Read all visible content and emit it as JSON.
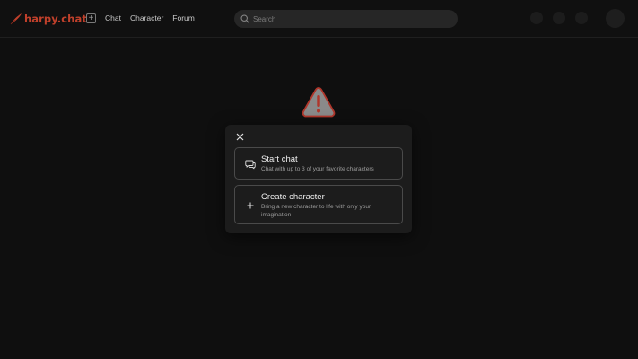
{
  "header": {
    "logo_text": "harpy.chat",
    "nav": [
      {
        "label": "Chat"
      },
      {
        "label": "Character"
      },
      {
        "label": "Forum"
      }
    ],
    "search": {
      "placeholder": "Search",
      "value": ""
    }
  },
  "modal": {
    "options": [
      {
        "title": "Start chat",
        "description": "Chat with up to 3 of your favorite characters",
        "icon": "chat-bubbles-icon"
      },
      {
        "title": "Create character",
        "description": "Bring a new character to life with only your imagination",
        "icon": "plus-icon"
      }
    ]
  },
  "colors": {
    "brand": "#c0402b",
    "background": "#0f0f0f",
    "modal": "#1c1c1c",
    "warning_fill": "#8a8a8a",
    "warning_mark": "#b0362b"
  }
}
